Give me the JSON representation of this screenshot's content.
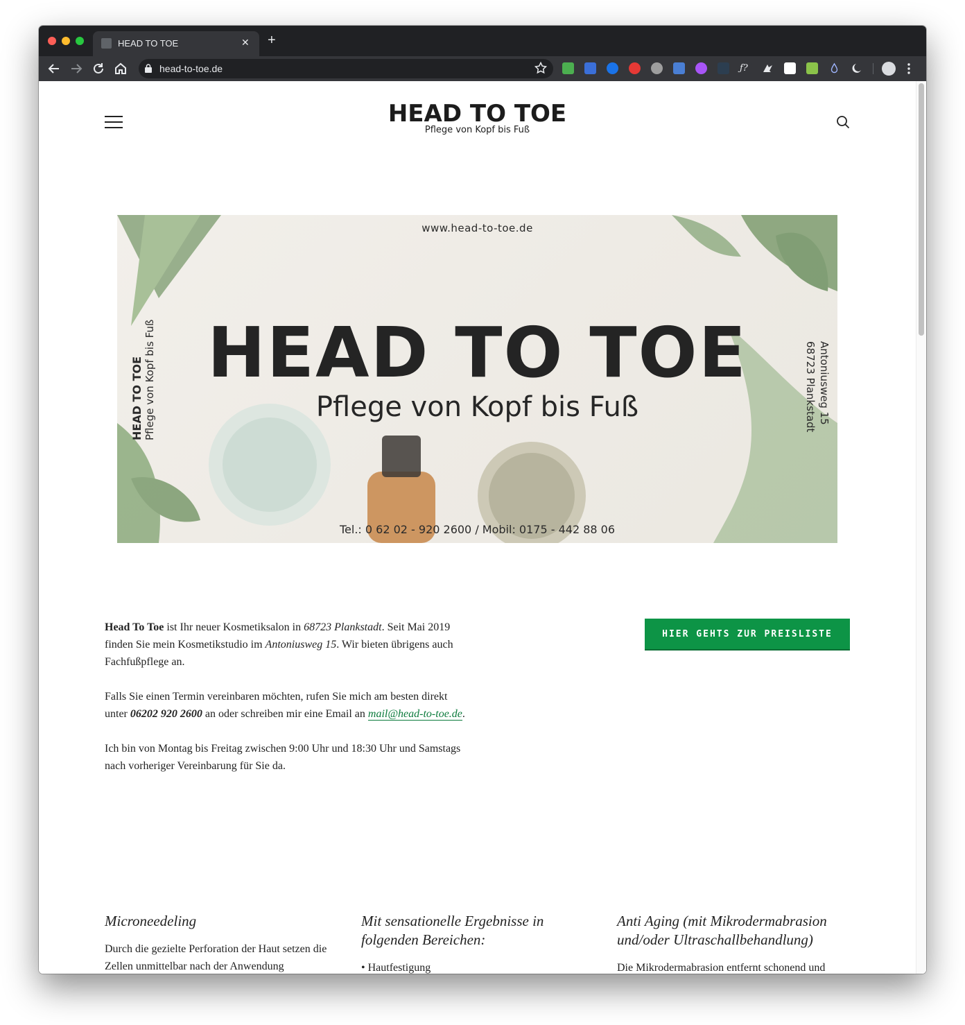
{
  "browser": {
    "tab_title": "HEAD TO TOE",
    "tab_close": "✕",
    "new_tab": "+",
    "url": "head-to-toe.de"
  },
  "site": {
    "logo_title": "HEAD TO TOE",
    "logo_subtitle": "Pflege von Kopf bis Fuß"
  },
  "banner": {
    "url": "www.head-to-toe.de",
    "title": "HEAD TO TOE",
    "subtitle": "Pflege von Kopf bis Fuß",
    "left_title": "HEAD TO TOE",
    "left_subtitle": "Pflege von Kopf bis Fuß",
    "address_street": "Antoniusweg 15",
    "address_city": "68723 Plankstadt",
    "phone": "Tel.: 0 62 02 - 920 2600  /  Mobil: 0175 - 442 88 06"
  },
  "intro": {
    "p1_bold": "Head To Toe",
    "p1_a": " ist Ihr neuer Kosmetiksalon in ",
    "p1_city": "68723 Plankstadt",
    "p1_b": ". Seit Mai 2019 finden Sie mein Kosmetikstudio im ",
    "p1_street": "Antoniusweg 15",
    "p1_c": ". Wir bieten übrigens auch Fachfußpflege an.",
    "p2_a": "Falls Sie einen Termin vereinbaren möchten, rufen Sie mich am besten direkt unter ",
    "p2_phone": "06202 920 2600",
    "p2_b": " an oder schreiben mir eine Email an ",
    "p2_email": "mail@head-to-toe.de",
    "p2_c": ".",
    "p3": "Ich bin von Montag bis Freitag zwischen 9:00 Uhr und 18:30 Uhr und Samstags nach vorheriger Vereinbarung für Sie da."
  },
  "cta_label": "HIER GEHTS ZUR PREISLISTE",
  "columns": [
    {
      "heading": "Microneedeling",
      "text": "Durch die gezielte Perforation der Haut setzen die Zellen unmittelbar nach der Anwendung"
    },
    {
      "heading": "Mit sensationelle Ergebnisse in folgenden Bereichen:",
      "text": "• Hautfestigung"
    },
    {
      "heading": "Anti Aging (mit Mikrodermabrasion und/oder Ultraschallbehandlung)",
      "text": "Die Mikrodermabrasion entfernt schonend und"
    }
  ],
  "colors": {
    "accent_green": "#0d9446",
    "browser_dark": "#202124",
    "browser_toolbar": "#35363a"
  }
}
